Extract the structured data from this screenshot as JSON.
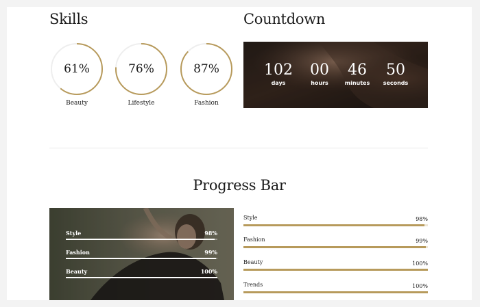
{
  "skills": {
    "title": "Skills",
    "items": [
      {
        "value": 61,
        "display": "61%",
        "label": "Beauty"
      },
      {
        "value": 76,
        "display": "76%",
        "label": "Lifestyle"
      },
      {
        "value": 87,
        "display": "87%",
        "label": "Fashion"
      }
    ]
  },
  "countdown": {
    "title": "Countdown",
    "units": [
      {
        "value": "102",
        "label": "days"
      },
      {
        "value": "00",
        "label": "hours"
      },
      {
        "value": "46",
        "label": "minutes"
      },
      {
        "value": "50",
        "label": "seconds"
      }
    ]
  },
  "progress": {
    "title": "Progress Bar",
    "photo_bars": [
      {
        "label": "Style",
        "display": "98%",
        "value": 98
      },
      {
        "label": "Fashion",
        "display": "99%",
        "value": 99
      },
      {
        "label": "Beauty",
        "display": "100%",
        "value": 100
      }
    ],
    "bars": [
      {
        "label": "Style",
        "display": "98%",
        "value": 98
      },
      {
        "label": "Fashion",
        "display": "99%",
        "value": 99
      },
      {
        "label": "Beauty",
        "display": "100%",
        "value": 100
      },
      {
        "label": "Trends",
        "display": "100%",
        "value": 100
      }
    ]
  },
  "colors": {
    "accent": "#b79a5b",
    "ring_track": "#eeeeee",
    "text": "#1a1a1a"
  }
}
